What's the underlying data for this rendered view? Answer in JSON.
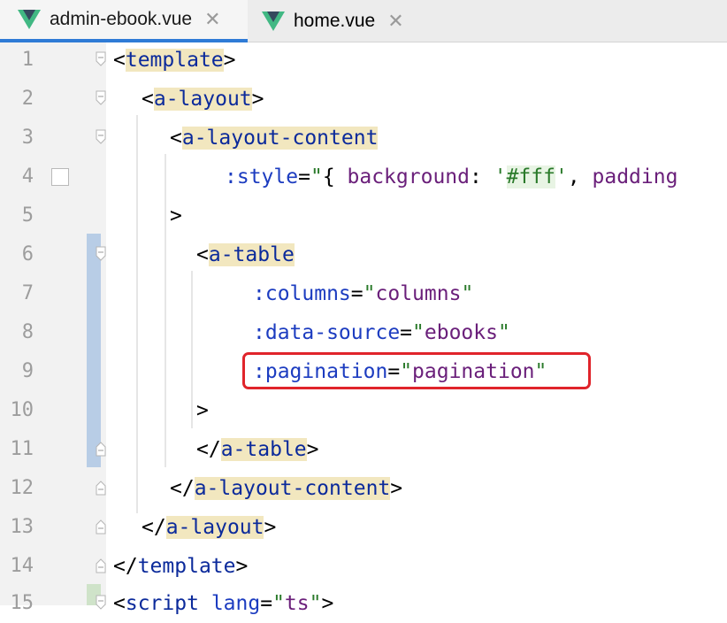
{
  "tabs": [
    {
      "label": "admin-ebook.vue",
      "active": true
    },
    {
      "label": "home.vue",
      "active": false
    }
  ],
  "close_glyph": "✕",
  "lines": [
    {
      "n": "1"
    },
    {
      "n": "2"
    },
    {
      "n": "3"
    },
    {
      "n": "4"
    },
    {
      "n": "5"
    },
    {
      "n": "6"
    },
    {
      "n": "7"
    },
    {
      "n": "8"
    },
    {
      "n": "9"
    },
    {
      "n": "10"
    },
    {
      "n": "11"
    },
    {
      "n": "12"
    },
    {
      "n": "13"
    },
    {
      "n": "14"
    },
    {
      "n": "15"
    }
  ],
  "code": {
    "l1": {
      "lt": "<",
      "tag": "template",
      "gt": ">"
    },
    "l2": {
      "lt": "<",
      "tag": "a-layout",
      "gt": ">"
    },
    "l3": {
      "lt": "<",
      "tag": "a-layout-content"
    },
    "l4": {
      "attr": ":style",
      "eq": "=",
      "q1": "\"",
      "brace": "{ ",
      "key": "background",
      "colon": ": ",
      "s1": "'",
      "color": "#fff",
      "s2": "'",
      "comma": ", ",
      "more": "padding"
    },
    "l5": {
      "gt": ">"
    },
    "l6": {
      "lt": "<",
      "tag": "a-table"
    },
    "l7": {
      "attr": ":columns",
      "eq": "=",
      "q1": "\"",
      "val": "columns",
      "q2": "\""
    },
    "l8": {
      "attr": ":data-source",
      "eq": "=",
      "q1": "\"",
      "val": "ebooks",
      "q2": "\""
    },
    "l9": {
      "attr": ":pagination",
      "eq": "=",
      "q1": "\"",
      "val": "pagination",
      "q2": "\""
    },
    "l10": {
      "gt": ">"
    },
    "l11": {
      "lt": "</",
      "tag": "a-table",
      "gt": ">"
    },
    "l12": {
      "lt": "</",
      "tag": "a-layout-content",
      "gt": ">"
    },
    "l13": {
      "lt": "</",
      "tag": "a-layout",
      "gt": ">"
    },
    "l14": {
      "lt": "</",
      "tag": "template",
      "gt": ">"
    },
    "l15": {
      "lt": "<",
      "tag": "script",
      "sp": " ",
      "attr": "lang",
      "eq": "=",
      "q1": "\"",
      "val": "ts",
      "q2": "\"",
      "gt": ">"
    }
  },
  "colors": {
    "accent": "#2f7bd6",
    "callout": "#e0242b",
    "vue_green": "#41b883",
    "vue_dark": "#35495e"
  }
}
